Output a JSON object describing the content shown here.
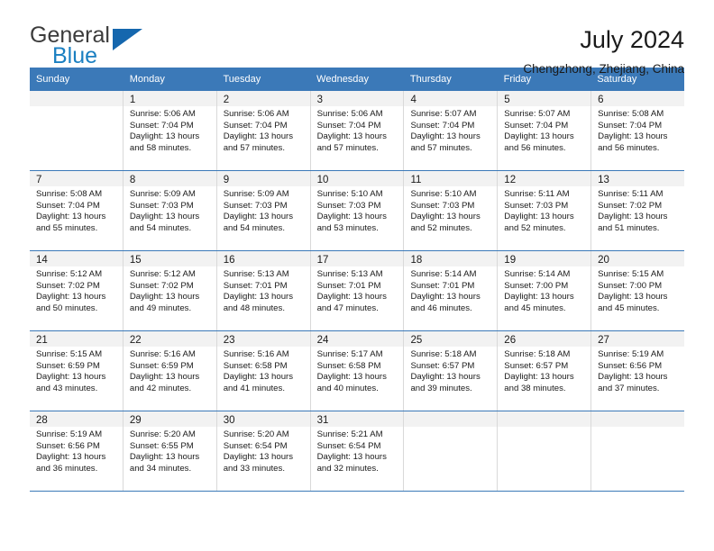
{
  "brand": {
    "name_top": "General",
    "name_bottom": "Blue",
    "triangle_color": "#1567ae",
    "blue_text_color": "#1a7fc1"
  },
  "header": {
    "title": "July 2024",
    "location": "Chengzhong, Zhejiang, China"
  },
  "theme": {
    "header_bar": "#3b79b8",
    "day_band": "#f2f2f2",
    "cell_border": "#d9d9d9"
  },
  "weekdays": [
    "Sunday",
    "Monday",
    "Tuesday",
    "Wednesday",
    "Thursday",
    "Friday",
    "Saturday"
  ],
  "weeks": [
    [
      {
        "day": "",
        "sunrise": "",
        "sunset": "",
        "daylight_1": "",
        "daylight_2": ""
      },
      {
        "day": "1",
        "sunrise": "Sunrise: 5:06 AM",
        "sunset": "Sunset: 7:04 PM",
        "daylight_1": "Daylight: 13 hours",
        "daylight_2": "and 58 minutes."
      },
      {
        "day": "2",
        "sunrise": "Sunrise: 5:06 AM",
        "sunset": "Sunset: 7:04 PM",
        "daylight_1": "Daylight: 13 hours",
        "daylight_2": "and 57 minutes."
      },
      {
        "day": "3",
        "sunrise": "Sunrise: 5:06 AM",
        "sunset": "Sunset: 7:04 PM",
        "daylight_1": "Daylight: 13 hours",
        "daylight_2": "and 57 minutes."
      },
      {
        "day": "4",
        "sunrise": "Sunrise: 5:07 AM",
        "sunset": "Sunset: 7:04 PM",
        "daylight_1": "Daylight: 13 hours",
        "daylight_2": "and 57 minutes."
      },
      {
        "day": "5",
        "sunrise": "Sunrise: 5:07 AM",
        "sunset": "Sunset: 7:04 PM",
        "daylight_1": "Daylight: 13 hours",
        "daylight_2": "and 56 minutes."
      },
      {
        "day": "6",
        "sunrise": "Sunrise: 5:08 AM",
        "sunset": "Sunset: 7:04 PM",
        "daylight_1": "Daylight: 13 hours",
        "daylight_2": "and 56 minutes."
      }
    ],
    [
      {
        "day": "7",
        "sunrise": "Sunrise: 5:08 AM",
        "sunset": "Sunset: 7:04 PM",
        "daylight_1": "Daylight: 13 hours",
        "daylight_2": "and 55 minutes."
      },
      {
        "day": "8",
        "sunrise": "Sunrise: 5:09 AM",
        "sunset": "Sunset: 7:03 PM",
        "daylight_1": "Daylight: 13 hours",
        "daylight_2": "and 54 minutes."
      },
      {
        "day": "9",
        "sunrise": "Sunrise: 5:09 AM",
        "sunset": "Sunset: 7:03 PM",
        "daylight_1": "Daylight: 13 hours",
        "daylight_2": "and 54 minutes."
      },
      {
        "day": "10",
        "sunrise": "Sunrise: 5:10 AM",
        "sunset": "Sunset: 7:03 PM",
        "daylight_1": "Daylight: 13 hours",
        "daylight_2": "and 53 minutes."
      },
      {
        "day": "11",
        "sunrise": "Sunrise: 5:10 AM",
        "sunset": "Sunset: 7:03 PM",
        "daylight_1": "Daylight: 13 hours",
        "daylight_2": "and 52 minutes."
      },
      {
        "day": "12",
        "sunrise": "Sunrise: 5:11 AM",
        "sunset": "Sunset: 7:03 PM",
        "daylight_1": "Daylight: 13 hours",
        "daylight_2": "and 52 minutes."
      },
      {
        "day": "13",
        "sunrise": "Sunrise: 5:11 AM",
        "sunset": "Sunset: 7:02 PM",
        "daylight_1": "Daylight: 13 hours",
        "daylight_2": "and 51 minutes."
      }
    ],
    [
      {
        "day": "14",
        "sunrise": "Sunrise: 5:12 AM",
        "sunset": "Sunset: 7:02 PM",
        "daylight_1": "Daylight: 13 hours",
        "daylight_2": "and 50 minutes."
      },
      {
        "day": "15",
        "sunrise": "Sunrise: 5:12 AM",
        "sunset": "Sunset: 7:02 PM",
        "daylight_1": "Daylight: 13 hours",
        "daylight_2": "and 49 minutes."
      },
      {
        "day": "16",
        "sunrise": "Sunrise: 5:13 AM",
        "sunset": "Sunset: 7:01 PM",
        "daylight_1": "Daylight: 13 hours",
        "daylight_2": "and 48 minutes."
      },
      {
        "day": "17",
        "sunrise": "Sunrise: 5:13 AM",
        "sunset": "Sunset: 7:01 PM",
        "daylight_1": "Daylight: 13 hours",
        "daylight_2": "and 47 minutes."
      },
      {
        "day": "18",
        "sunrise": "Sunrise: 5:14 AM",
        "sunset": "Sunset: 7:01 PM",
        "daylight_1": "Daylight: 13 hours",
        "daylight_2": "and 46 minutes."
      },
      {
        "day": "19",
        "sunrise": "Sunrise: 5:14 AM",
        "sunset": "Sunset: 7:00 PM",
        "daylight_1": "Daylight: 13 hours",
        "daylight_2": "and 45 minutes."
      },
      {
        "day": "20",
        "sunrise": "Sunrise: 5:15 AM",
        "sunset": "Sunset: 7:00 PM",
        "daylight_1": "Daylight: 13 hours",
        "daylight_2": "and 45 minutes."
      }
    ],
    [
      {
        "day": "21",
        "sunrise": "Sunrise: 5:15 AM",
        "sunset": "Sunset: 6:59 PM",
        "daylight_1": "Daylight: 13 hours",
        "daylight_2": "and 43 minutes."
      },
      {
        "day": "22",
        "sunrise": "Sunrise: 5:16 AM",
        "sunset": "Sunset: 6:59 PM",
        "daylight_1": "Daylight: 13 hours",
        "daylight_2": "and 42 minutes."
      },
      {
        "day": "23",
        "sunrise": "Sunrise: 5:16 AM",
        "sunset": "Sunset: 6:58 PM",
        "daylight_1": "Daylight: 13 hours",
        "daylight_2": "and 41 minutes."
      },
      {
        "day": "24",
        "sunrise": "Sunrise: 5:17 AM",
        "sunset": "Sunset: 6:58 PM",
        "daylight_1": "Daylight: 13 hours",
        "daylight_2": "and 40 minutes."
      },
      {
        "day": "25",
        "sunrise": "Sunrise: 5:18 AM",
        "sunset": "Sunset: 6:57 PM",
        "daylight_1": "Daylight: 13 hours",
        "daylight_2": "and 39 minutes."
      },
      {
        "day": "26",
        "sunrise": "Sunrise: 5:18 AM",
        "sunset": "Sunset: 6:57 PM",
        "daylight_1": "Daylight: 13 hours",
        "daylight_2": "and 38 minutes."
      },
      {
        "day": "27",
        "sunrise": "Sunrise: 5:19 AM",
        "sunset": "Sunset: 6:56 PM",
        "daylight_1": "Daylight: 13 hours",
        "daylight_2": "and 37 minutes."
      }
    ],
    [
      {
        "day": "28",
        "sunrise": "Sunrise: 5:19 AM",
        "sunset": "Sunset: 6:56 PM",
        "daylight_1": "Daylight: 13 hours",
        "daylight_2": "and 36 minutes."
      },
      {
        "day": "29",
        "sunrise": "Sunrise: 5:20 AM",
        "sunset": "Sunset: 6:55 PM",
        "daylight_1": "Daylight: 13 hours",
        "daylight_2": "and 34 minutes."
      },
      {
        "day": "30",
        "sunrise": "Sunrise: 5:20 AM",
        "sunset": "Sunset: 6:54 PM",
        "daylight_1": "Daylight: 13 hours",
        "daylight_2": "and 33 minutes."
      },
      {
        "day": "31",
        "sunrise": "Sunrise: 5:21 AM",
        "sunset": "Sunset: 6:54 PM",
        "daylight_1": "Daylight: 13 hours",
        "daylight_2": "and 32 minutes."
      },
      {
        "day": "",
        "sunrise": "",
        "sunset": "",
        "daylight_1": "",
        "daylight_2": ""
      },
      {
        "day": "",
        "sunrise": "",
        "sunset": "",
        "daylight_1": "",
        "daylight_2": ""
      },
      {
        "day": "",
        "sunrise": "",
        "sunset": "",
        "daylight_1": "",
        "daylight_2": ""
      }
    ]
  ]
}
